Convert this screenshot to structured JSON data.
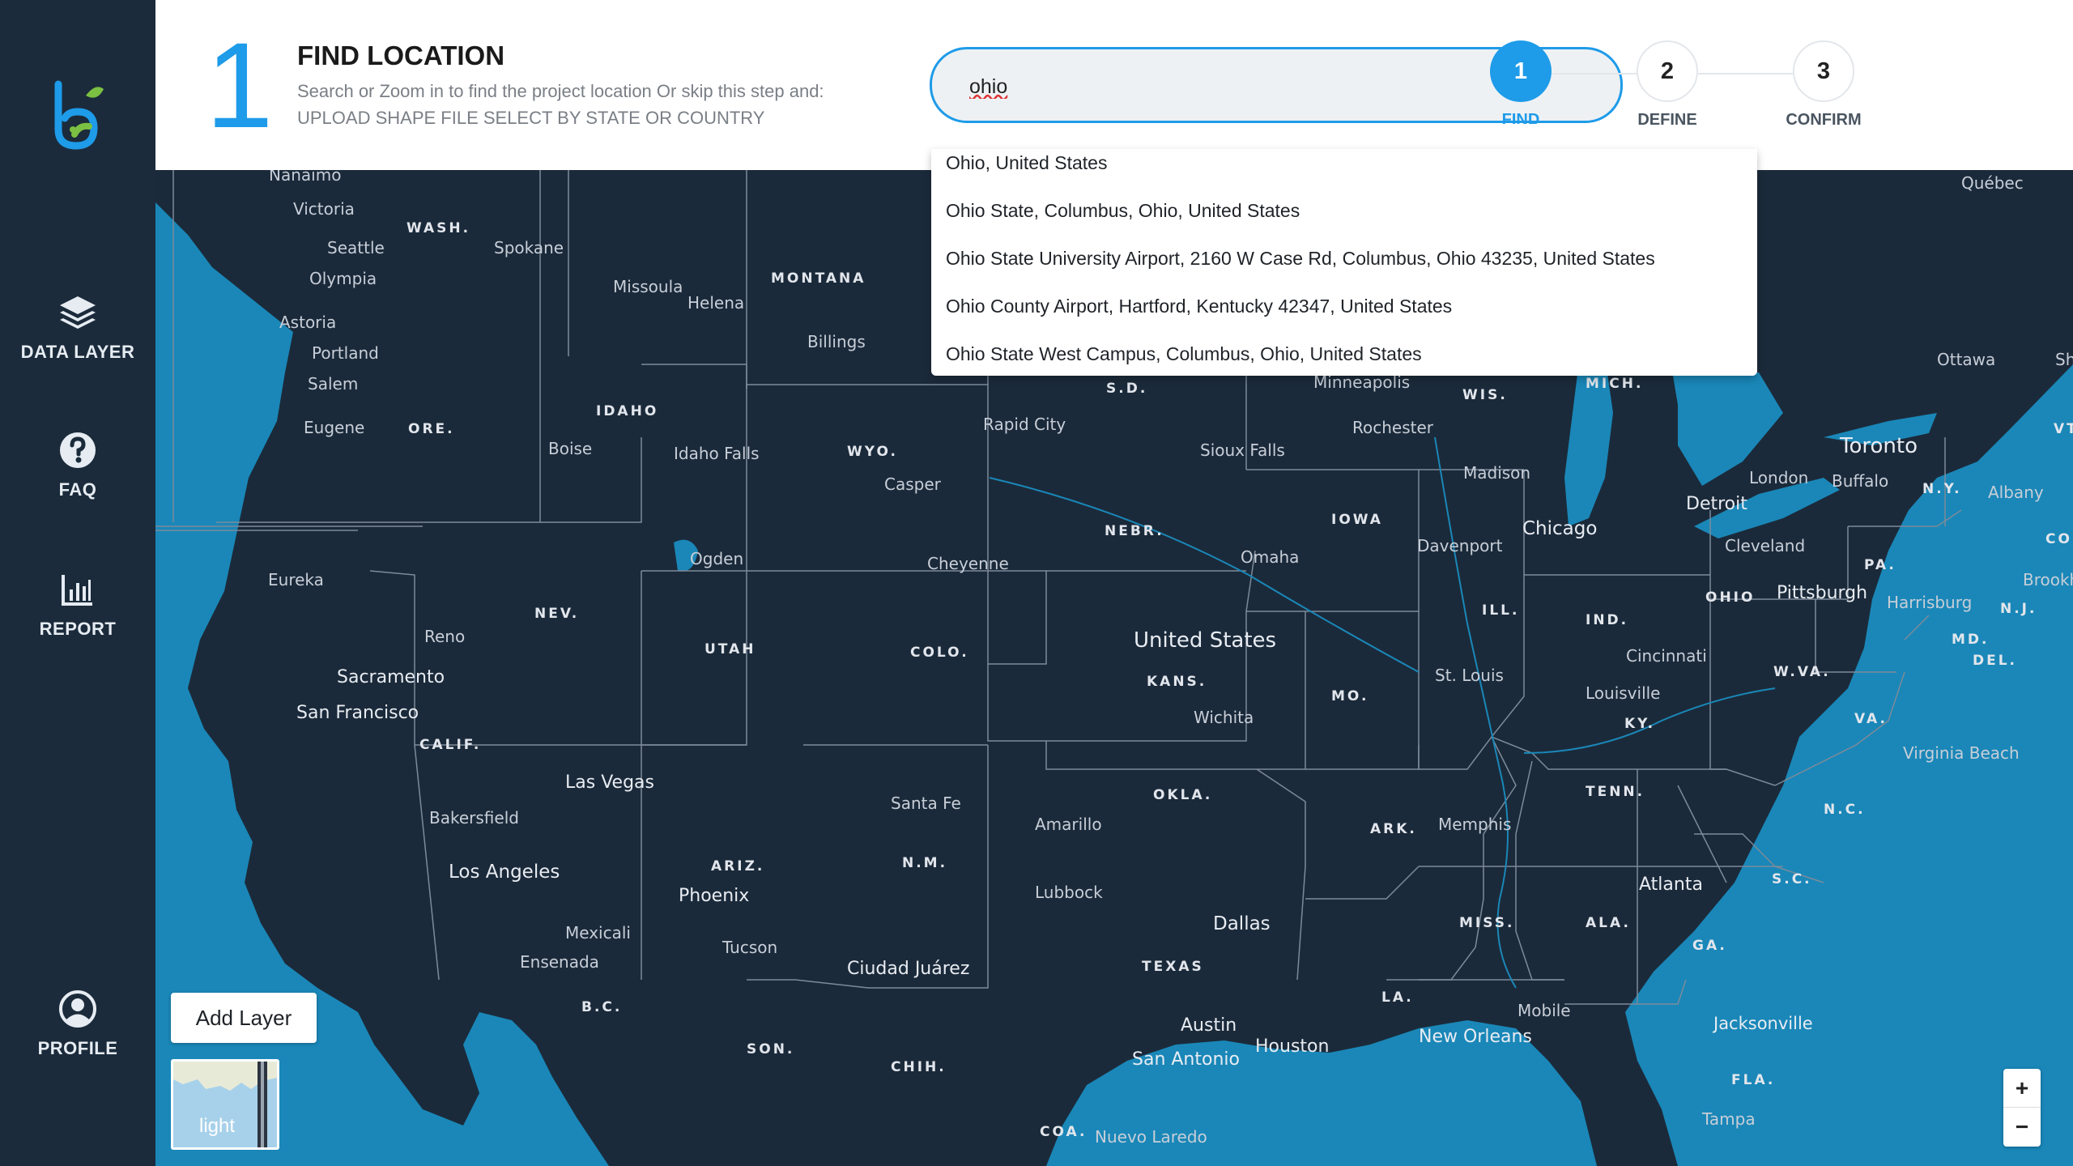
{
  "sidebar": {
    "items": [
      {
        "label": "DATA LAYER",
        "icon": "layers-icon"
      },
      {
        "label": "FAQ",
        "icon": "help-circle-icon"
      },
      {
        "label": "REPORT",
        "icon": "bar-chart-icon"
      },
      {
        "label": "PROFILE",
        "icon": "user-circle-icon"
      }
    ]
  },
  "header": {
    "step_number": "1",
    "title": "FIND LOCATION",
    "description_line1": "Search or Zoom in to find the project location Or skip this step and:",
    "description_line2": "UPLOAD SHAPE FILE SELECT BY STATE OR COUNTRY"
  },
  "search": {
    "value": "ohio"
  },
  "steps": [
    {
      "number": "1",
      "label": "FIND",
      "active": true
    },
    {
      "number": "2",
      "label": "DEFINE",
      "active": false
    },
    {
      "number": "3",
      "label": "CONFIRM",
      "active": false
    }
  ],
  "suggestions": [
    "Ohio, United States",
    "Ohio State, Columbus, Ohio, United States",
    "Ohio State University Airport, 2160 W Case Rd, Columbus, Ohio 43235, United States",
    "Ohio County Airport, Hartford, Kentucky 42347, United States",
    "Ohio State West Campus, Columbus, Ohio, United States"
  ],
  "map": {
    "add_layer_label": "Add Layer",
    "basemap_label": "light",
    "zoom_in": "+",
    "zoom_out": "−",
    "colors": {
      "water": "#1a87b8",
      "land": "#1b2a3a",
      "borders": "#7d8a99"
    },
    "country_label": "United States",
    "cities": [
      "Nanaimo",
      "Victoria",
      "Seattle",
      "Spokane",
      "Olympia",
      "Missoula",
      "Helena",
      "Astoria",
      "Portland",
      "Salem",
      "Eugene",
      "Billings",
      "Boise",
      "Idaho Falls",
      "Rapid City",
      "Casper",
      "Sioux Falls",
      "Minneapolis",
      "Rochester",
      "Madison",
      "Toronto",
      "Ottawa",
      "London",
      "Buffalo",
      "Albany",
      "Detroit",
      "Cleveland",
      "Chicago",
      "Davenport",
      "Omaha",
      "Ogden",
      "Cheyenne",
      "Eureka",
      "Reno",
      "Sacramento",
      "San Francisco",
      "Pittsburgh",
      "Harrisburg",
      "Brookh",
      "Cincinnati",
      "Louisville",
      "St. Louis",
      "Wichita",
      "Las Vegas",
      "Bakersfield",
      "Los Angeles",
      "Santa Fe",
      "Amarillo",
      "Memphis",
      "Virginia Beach",
      "Lubbock",
      "Phoenix",
      "Mexicali",
      "Ensenada",
      "Tucson",
      "Ciudad Juárez",
      "Dallas",
      "Atlanta",
      "Mobile",
      "Jacksonville",
      "Austin",
      "Houston",
      "New Orleans",
      "San Antonio",
      "Nuevo Laredo",
      "Tampa",
      "Québec"
    ],
    "states": [
      "WASH.",
      "MONTANA",
      "ORE.",
      "IDAHO",
      "WYO.",
      "S.D.",
      "WIS.",
      "MICH.",
      "NEBR.",
      "IOWA",
      "NEV.",
      "UTAH",
      "COLO.",
      "KANS.",
      "MO.",
      "ILL.",
      "IND.",
      "OHIO",
      "PA.",
      "N.Y.",
      "CALIF.",
      "W.VA.",
      "KY.",
      "VA.",
      "MD.",
      "DEL.",
      "N.J.",
      "OKLA.",
      "ARK.",
      "TENN.",
      "N.C.",
      "ARIZ.",
      "N.M.",
      "S.C.",
      "MISS.",
      "ALA.",
      "GA.",
      "TEXAS",
      "LA.",
      "FLA.",
      "B.C.",
      "SON.",
      "CHIH.",
      "COA.",
      "CON",
      "VT",
      "Sh"
    ]
  }
}
